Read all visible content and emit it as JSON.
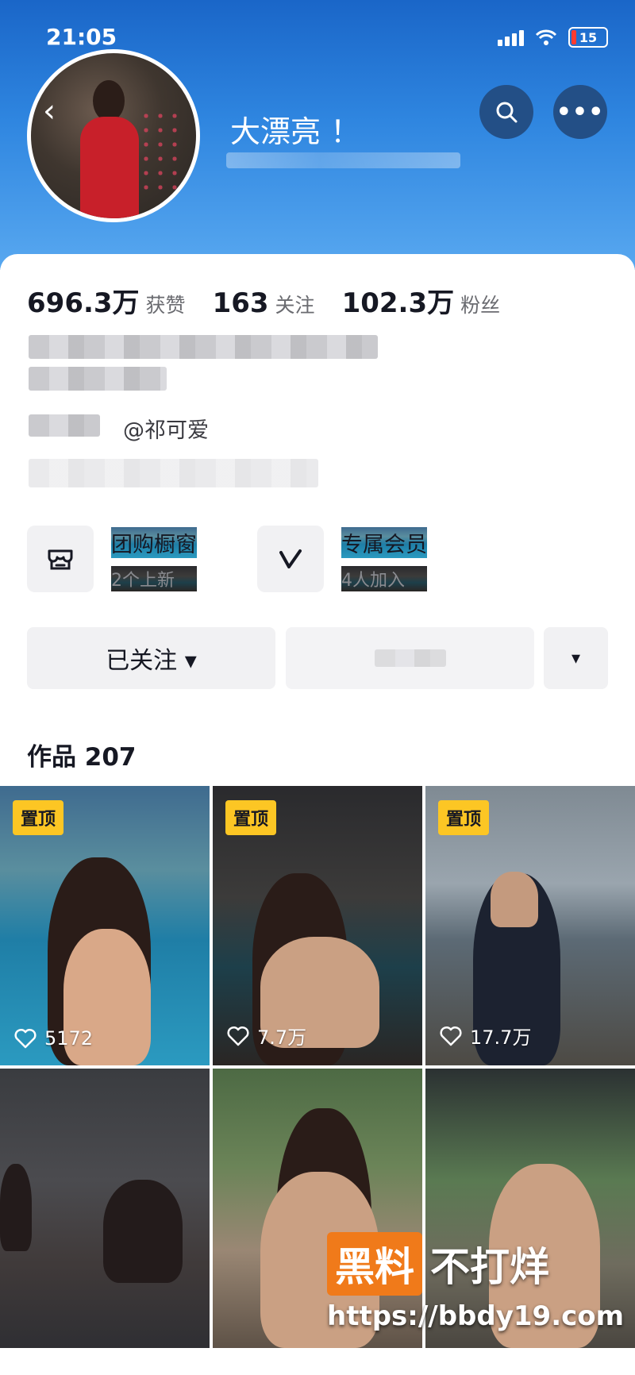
{
  "status_bar": {
    "time": "21:05",
    "battery": "15"
  },
  "header": {
    "name": "大漂亮 ！"
  },
  "stats": [
    {
      "value": "696.3万",
      "label": "获赞"
    },
    {
      "value": "163",
      "label": "关注"
    },
    {
      "value": "102.3万",
      "label": "粉丝"
    }
  ],
  "bio": {
    "mention": "@祁可爱"
  },
  "shortcuts": [
    {
      "title": "团购橱窗",
      "subtitle": "2个上新"
    },
    {
      "title": "专属会员",
      "subtitle": "4人加入"
    }
  ],
  "buttons": {
    "follow": "已关注 ▾",
    "dropdown": "▾"
  },
  "works": {
    "title": "作品 207"
  },
  "tiles": [
    {
      "pinned": "置顶",
      "likes": "5172"
    },
    {
      "pinned": "置顶",
      "likes": "7.7万"
    },
    {
      "pinned": "置顶",
      "likes": "17.7万"
    },
    {
      "pinned": "",
      "likes": ""
    },
    {
      "pinned": "",
      "likes": ""
    },
    {
      "pinned": "",
      "likes": ""
    }
  ],
  "watermark": {
    "brand_box": "黑料",
    "brand_rest": "不打烊",
    "url": "https://bbdy19.com"
  },
  "icons": [
    "back-icon",
    "search-icon",
    "more-icon",
    "shop-icon",
    "vip-icon",
    "heart-icon",
    "caret-down-icon"
  ]
}
